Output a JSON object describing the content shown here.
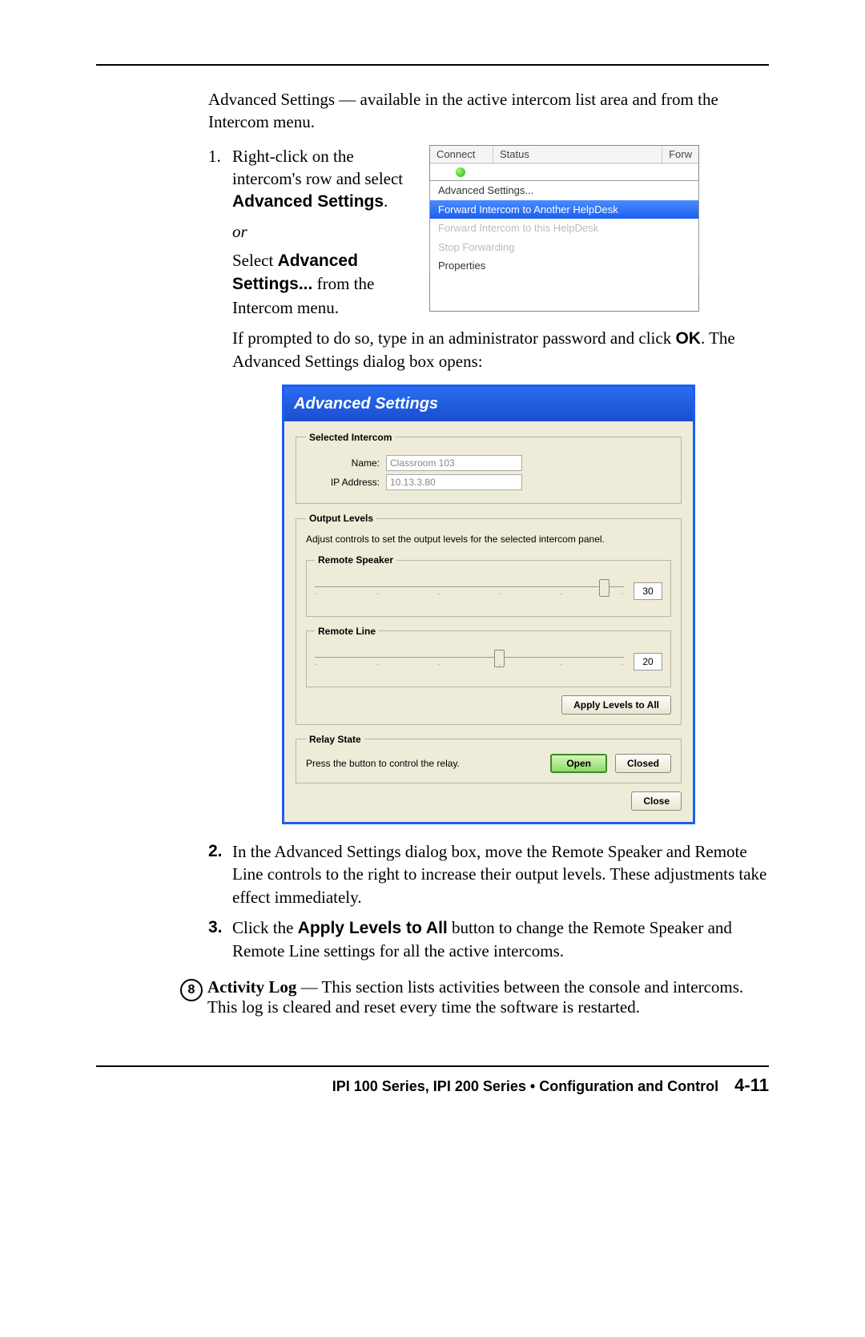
{
  "introText": "Advanced Settings — available in the active intercom list area and from the Intercom menu.",
  "step1": {
    "num": "1.",
    "textA": "Right-click on the intercom's row and select ",
    "bold1": "Advanced Settings",
    "textB": ".",
    "or": "or",
    "textC": "Select ",
    "bold2": "Advanced Settings...",
    "textD": " from the Intercom menu."
  },
  "contextMenu": {
    "colConnect": "Connect",
    "colStatus": "Status",
    "colForw": "Forw",
    "items": [
      "Advanced Settings...",
      "Forward Intercom to Another HelpDesk",
      "Forward Intercom to this HelpDesk",
      "Stop Forwarding",
      "Properties"
    ]
  },
  "afterStep1": {
    "l1": "If prompted to do so, type in an administrator password and click ",
    "ok": "OK",
    "l2": ".  The Advanced Settings dialog box opens:"
  },
  "dialog": {
    "title": "Advanced Settings",
    "selectedIntercom": {
      "legend": "Selected Intercom",
      "nameLabel": "Name:",
      "nameValue": "Classroom 103",
      "ipLabel": "IP Address:",
      "ipValue": "10.13.3.80"
    },
    "outputLevels": {
      "legend": "Output Levels",
      "desc": "Adjust controls to set the output levels for the selected intercom panel.",
      "remoteSpeakerLegend": "Remote Speaker",
      "remoteSpeakerValue": "30",
      "remoteLineLegend": "Remote Line",
      "remoteLineValue": "20",
      "applyBtn": "Apply Levels to All"
    },
    "relayState": {
      "legend": "Relay State",
      "desc": "Press the button to control the relay.",
      "openBtn": "Open",
      "closedBtn": "Closed"
    },
    "closeBtn": "Close"
  },
  "step2": {
    "num": "2.",
    "text": "In the Advanced Settings dialog box, move the Remote Speaker and Remote Line controls to the right to increase their output levels.  These adjustments take effect immediately."
  },
  "step3": {
    "num": "3.",
    "textA": "Click the ",
    "bold": "Apply Levels to All",
    "textB": " button to change the Remote Speaker and Remote Line settings for all the active intercoms."
  },
  "item8": {
    "circ": "8",
    "title": "Activity Log",
    "text": " — This section lists activities between the console and intercoms.  This log is cleared and reset every time the software is restarted."
  },
  "footer": {
    "title": "IPI 100 Series, IPI 200 Series • Configuration and Control",
    "page": "4-11"
  }
}
